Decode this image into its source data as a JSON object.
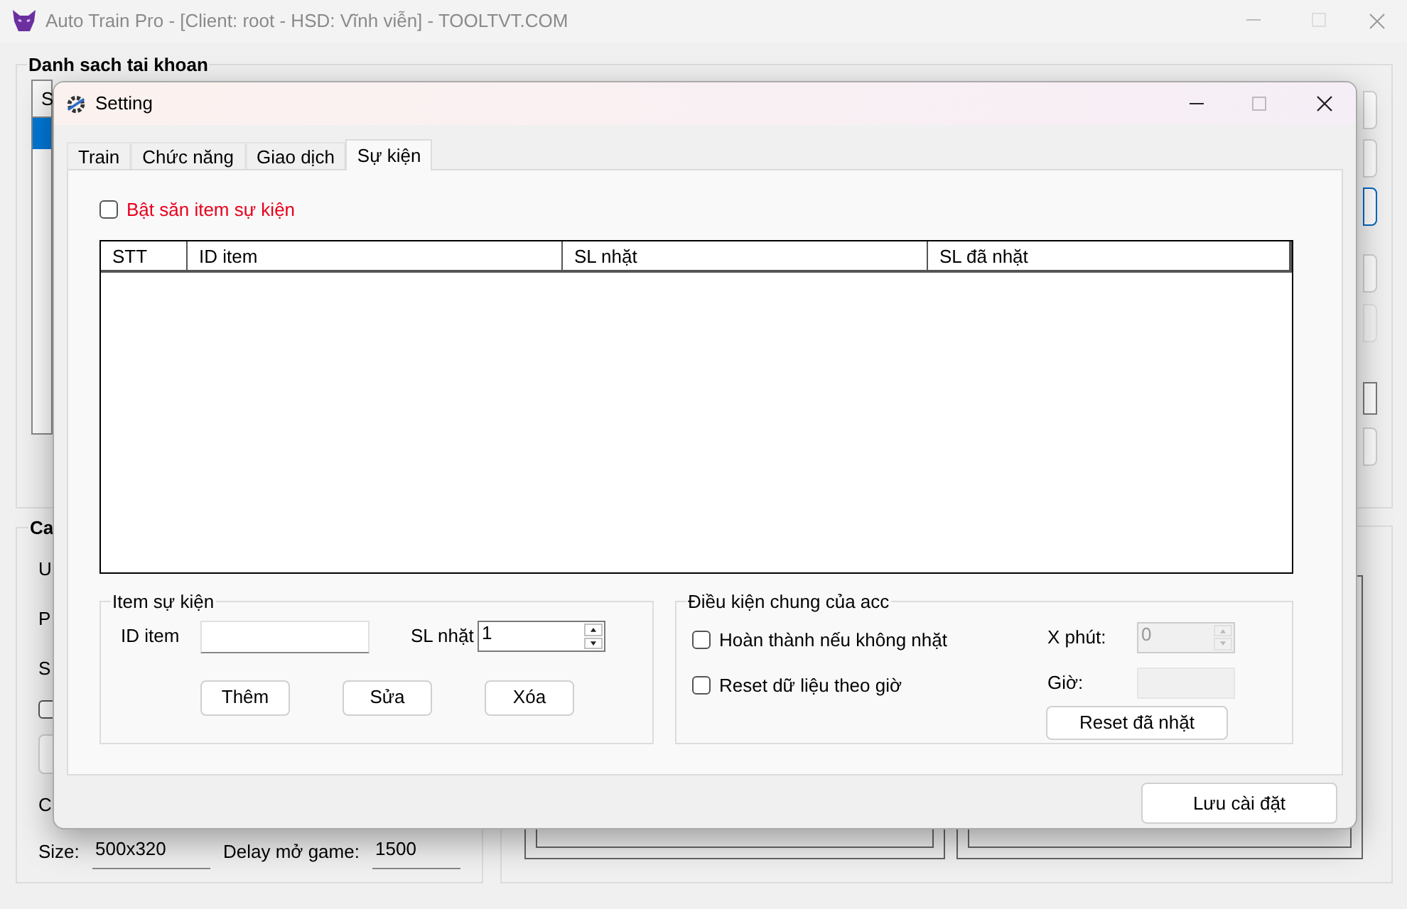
{
  "main_window": {
    "title": "Auto Train Pro - [Client: root - HSD: Vĩnh viễn] - TOOLTVT.COM",
    "account_group": {
      "title": "Danh sach tai khoan",
      "list_header": "S"
    },
    "config_group": {
      "title": "Ca",
      "labels": [
        "U",
        "P",
        "S"
      ],
      "checkbox": {
        "checked": false
      },
      "label_bottom": "C",
      "size_label": "Size:",
      "size_value": "500x320",
      "delay_label": "Delay mở game:",
      "delay_value": "1500"
    }
  },
  "dialog": {
    "title": "Setting",
    "tabs": [
      {
        "label": "Train",
        "selected": false
      },
      {
        "label": "Chức năng",
        "selected": false
      },
      {
        "label": "Giao dịch",
        "selected": false
      },
      {
        "label": "Sự kiện",
        "selected": true
      }
    ],
    "event_hunt": {
      "label": "Bật săn item sự kiện",
      "checked": false
    },
    "table": {
      "columns": [
        "STT",
        "ID item",
        "SL nhặt",
        "SL đã nhặt"
      ]
    },
    "item_group": {
      "title": "Item sự kiện",
      "id_label": "ID item",
      "qty_label": "SL nhặt",
      "qty_value": "1",
      "buttons": [
        "Thêm",
        "Sửa",
        "Xóa"
      ]
    },
    "conditions_group": {
      "title": "Điều kiện chung của acc",
      "options": [
        {
          "label": "Hoàn thành nếu không nhặt",
          "checked": false
        },
        {
          "label": "Reset dữ liệu theo giờ",
          "checked": false
        }
      ],
      "minutes_label": "X phút:",
      "minutes_value": "0",
      "minutes_disabled": true,
      "hour_label": "Giờ:",
      "hour_disabled": true,
      "reset_button": "Reset đã nhặt"
    },
    "save_button": "Lưu cài đặt"
  }
}
